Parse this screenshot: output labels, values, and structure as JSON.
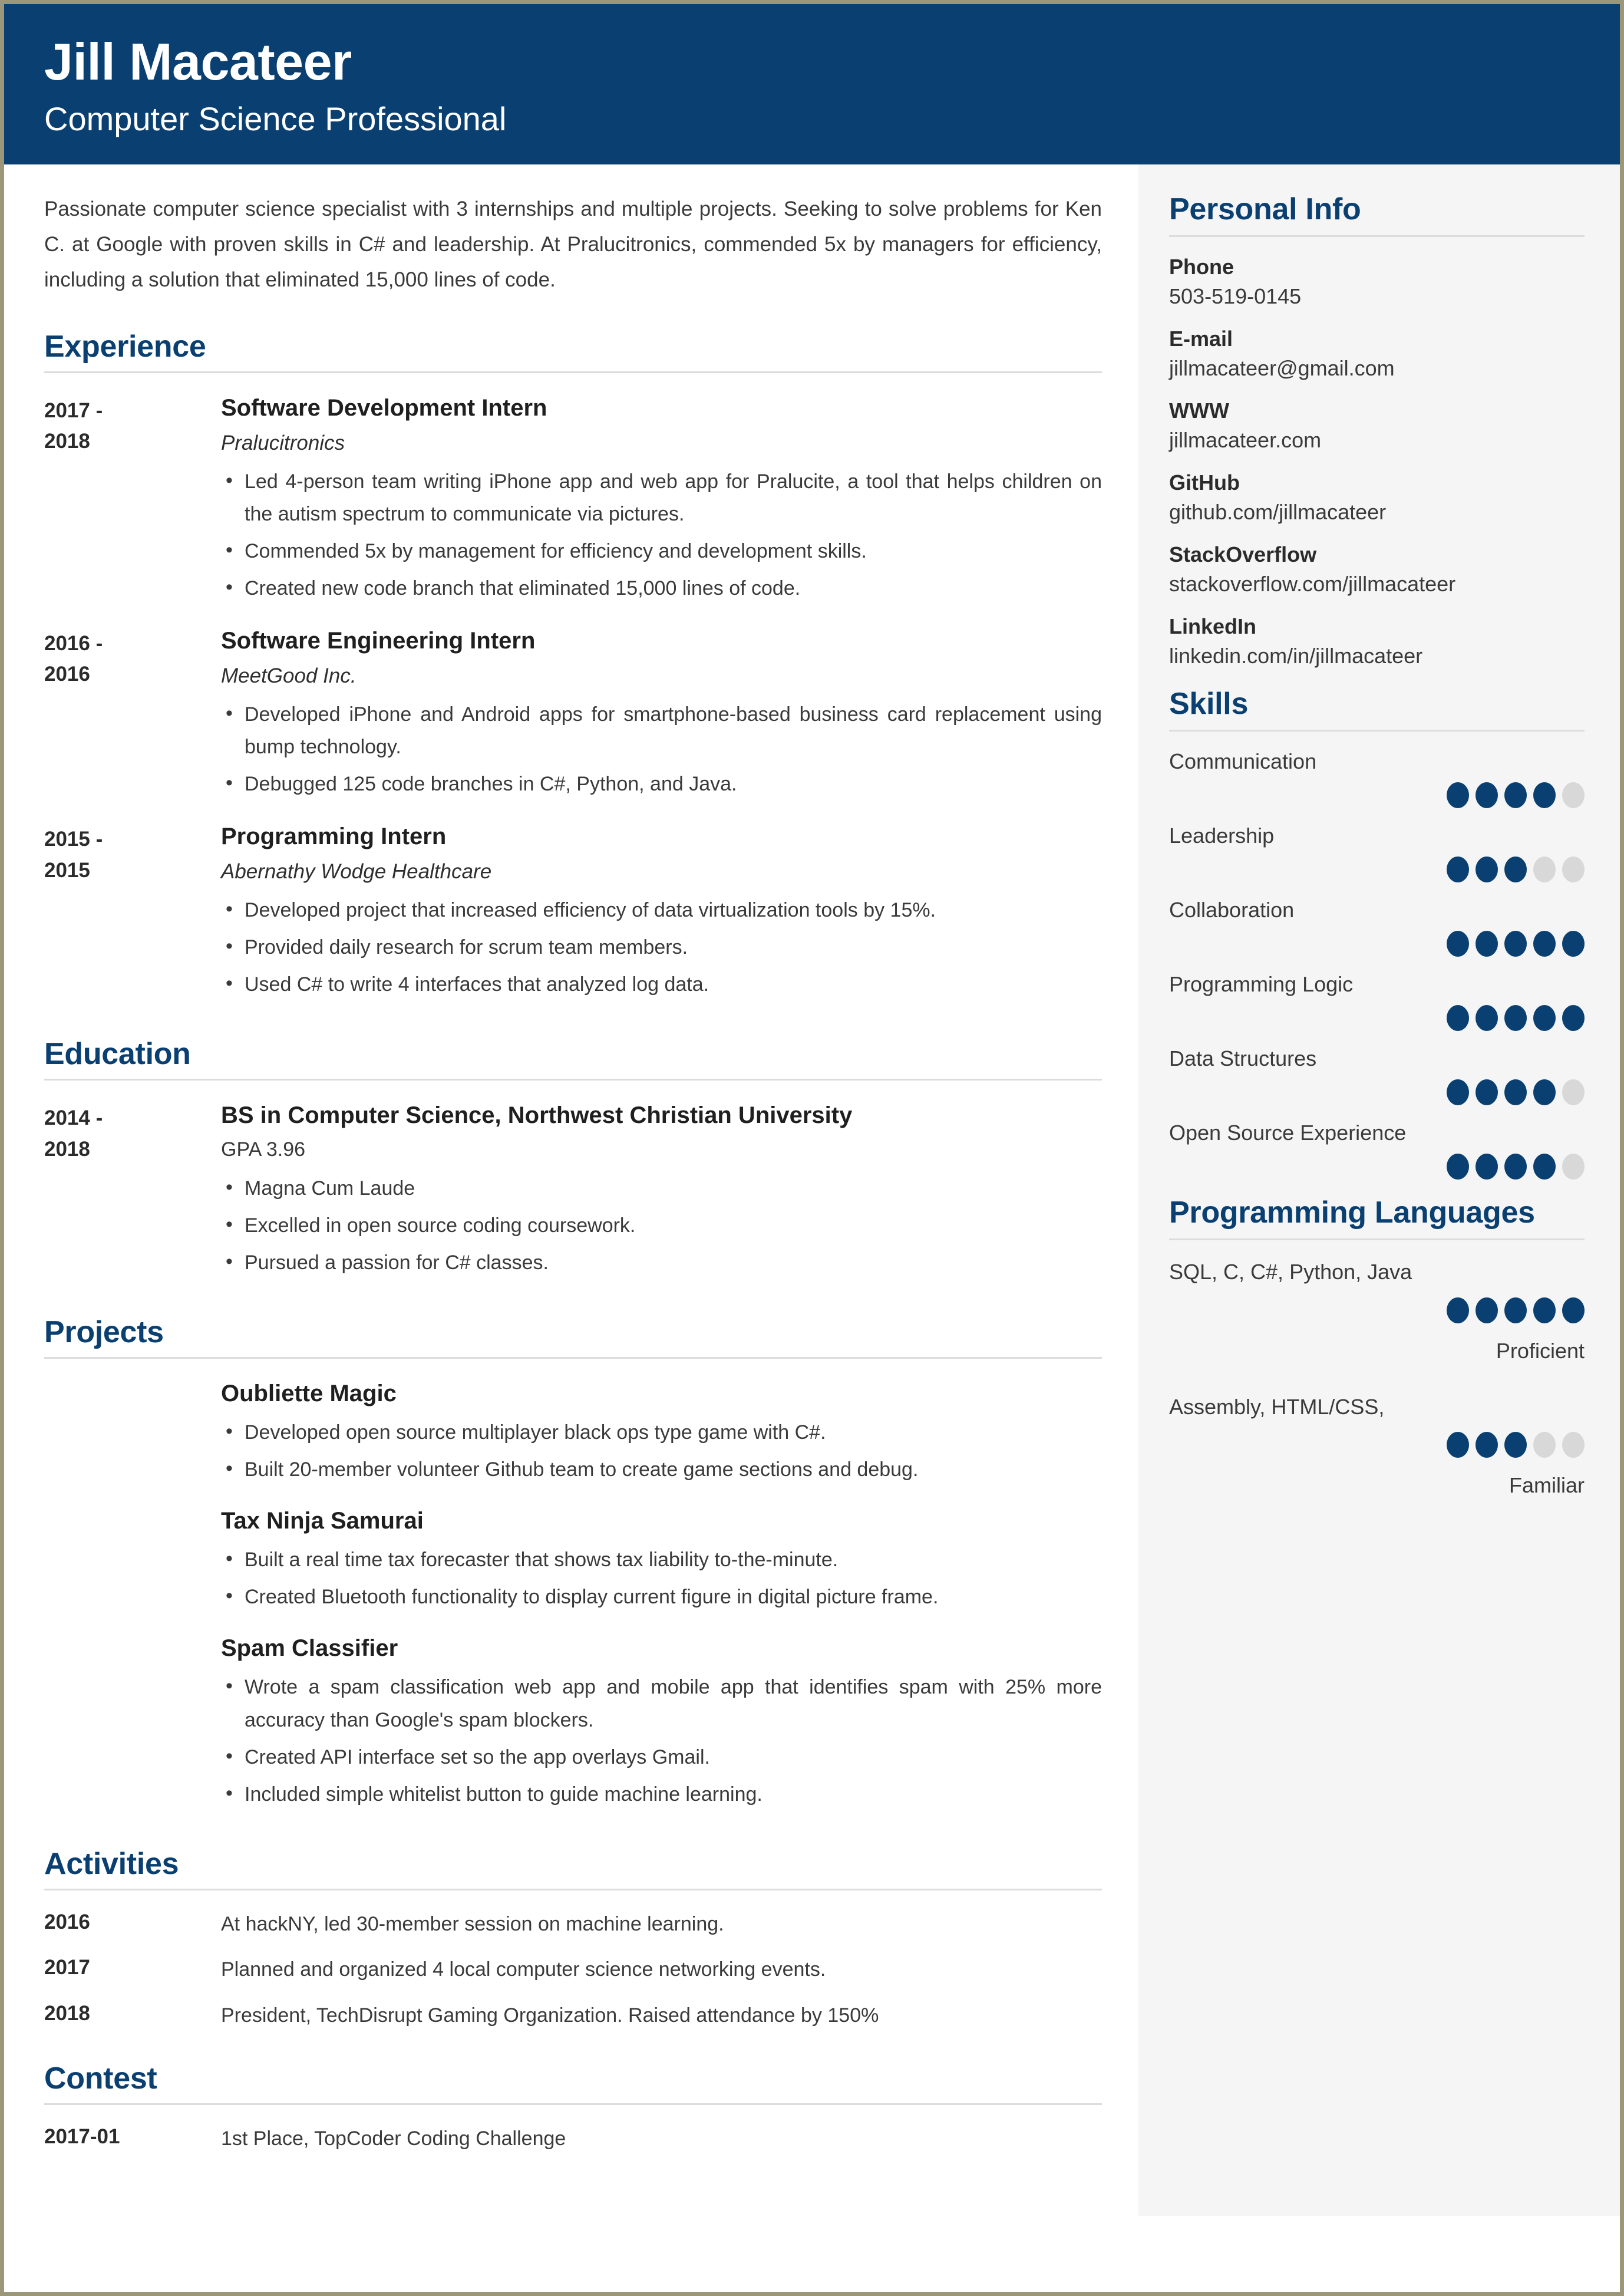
{
  "theme": {
    "navy": "#0a4071",
    "sidebar_bg": "#f5f5f5",
    "rule": "#dcdcdc",
    "dot_off": "#d8d8d8",
    "page_border": "#9d977a"
  },
  "header": {
    "name": "Jill Macateer",
    "title": "Computer Science Professional"
  },
  "summary": "Passionate computer science specialist with 3 internships and multiple projects. Seeking to solve problems for Ken C. at Google with proven skills in C# and leadership. At Pralucitronics, commended 5x by managers for efficiency, including a solution that eliminated 15,000 lines of code.",
  "sections": {
    "experience": {
      "heading": "Experience",
      "entries": [
        {
          "date_start": "2017 -",
          "date_end": "2018",
          "title": "Software Development Intern",
          "org": "Pralucitronics",
          "bullets": [
            "Led 4-person team writing iPhone app and web app for Pralucite, a tool that helps children on the autism spectrum to communicate via pictures.",
            "Commended 5x by management for efficiency and development skills.",
            "Created new code branch that eliminated 15,000 lines of code."
          ]
        },
        {
          "date_start": "2016 -",
          "date_end": "2016",
          "title": "Software Engineering Intern",
          "org": "MeetGood Inc.",
          "bullets": [
            "Developed iPhone and Android apps for smartphone-based business card replacement using bump technology.",
            "Debugged 125 code branches in C#, Python, and Java."
          ]
        },
        {
          "date_start": "2015 -",
          "date_end": "2015",
          "title": "Programming Intern",
          "org": "Abernathy Wodge Healthcare",
          "bullets": [
            "Developed project that increased efficiency of data virtualization tools by 15%.",
            "Provided daily research for scrum team members.",
            "Used C# to write 4 interfaces that analyzed log data."
          ]
        }
      ]
    },
    "education": {
      "heading": "Education",
      "entries": [
        {
          "date_start": "2014 -",
          "date_end": "2018",
          "title": "BS in Computer Science, Northwest Christian University",
          "detail": "GPA 3.96",
          "bullets": [
            "Magna Cum Laude",
            "Excelled in open source coding coursework.",
            "Pursued a passion for C# classes."
          ]
        }
      ]
    },
    "projects": {
      "heading": "Projects",
      "entries": [
        {
          "title": "Oubliette Magic",
          "bullets": [
            "Developed open source multiplayer black ops type game with C#.",
            "Built 20-member volunteer Github team to create game sections and debug."
          ]
        },
        {
          "title": "Tax Ninja Samurai",
          "bullets": [
            "Built a real time tax forecaster that shows tax liability to-the-minute.",
            "Created Bluetooth functionality to display current figure in digital picture frame."
          ]
        },
        {
          "title": "Spam Classifier",
          "bullets": [
            "Wrote a spam classification web app and mobile app that identifies spam with 25% more accuracy than Google's spam blockers.",
            "Created API interface set so the app overlays Gmail.",
            "Included simple whitelist button to guide machine learning."
          ]
        }
      ]
    },
    "activities": {
      "heading": "Activities",
      "rows": [
        {
          "date": "2016",
          "text": "At hackNY, led 30-member session on machine learning."
        },
        {
          "date": "2017",
          "text": "Planned and organized 4 local computer science networking events."
        },
        {
          "date": "2018",
          "text": "President, TechDisrupt Gaming Organization. Raised attendance by 150%"
        }
      ]
    },
    "contest": {
      "heading": "Contest",
      "rows": [
        {
          "date": "2017-01",
          "text": "1st Place, TopCoder Coding Challenge"
        }
      ]
    }
  },
  "sidebar": {
    "personal_info": {
      "heading": "Personal Info",
      "items": [
        {
          "label": "Phone",
          "value": "503-519-0145"
        },
        {
          "label": "E-mail",
          "value": "jillmacateer@gmail.com"
        },
        {
          "label": "WWW",
          "value": "jillmacateer.com"
        },
        {
          "label": "GitHub",
          "value": "github.com/jillmacateer"
        },
        {
          "label": "StackOverflow",
          "value": "stackoverflow.com/jillmacateer"
        },
        {
          "label": "LinkedIn",
          "value": "linkedin.com/in/jillmacateer"
        }
      ]
    },
    "skills": {
      "heading": "Skills",
      "max": 5,
      "items": [
        {
          "name": "Communication",
          "rating": 4
        },
        {
          "name": "Leadership",
          "rating": 3
        },
        {
          "name": "Collaboration",
          "rating": 5
        },
        {
          "name": "Programming Logic",
          "rating": 5
        },
        {
          "name": "Data Structures",
          "rating": 4
        },
        {
          "name": "Open Source Experience",
          "rating": 4
        }
      ]
    },
    "programming_languages": {
      "heading": "Programming Languages",
      "max": 5,
      "groups": [
        {
          "languages": "SQL, C, C#,  Python, Java",
          "rating": 5,
          "level": "Proficient"
        },
        {
          "languages": "Assembly, HTML/CSS,",
          "rating": 3,
          "level": "Familiar"
        }
      ]
    }
  }
}
